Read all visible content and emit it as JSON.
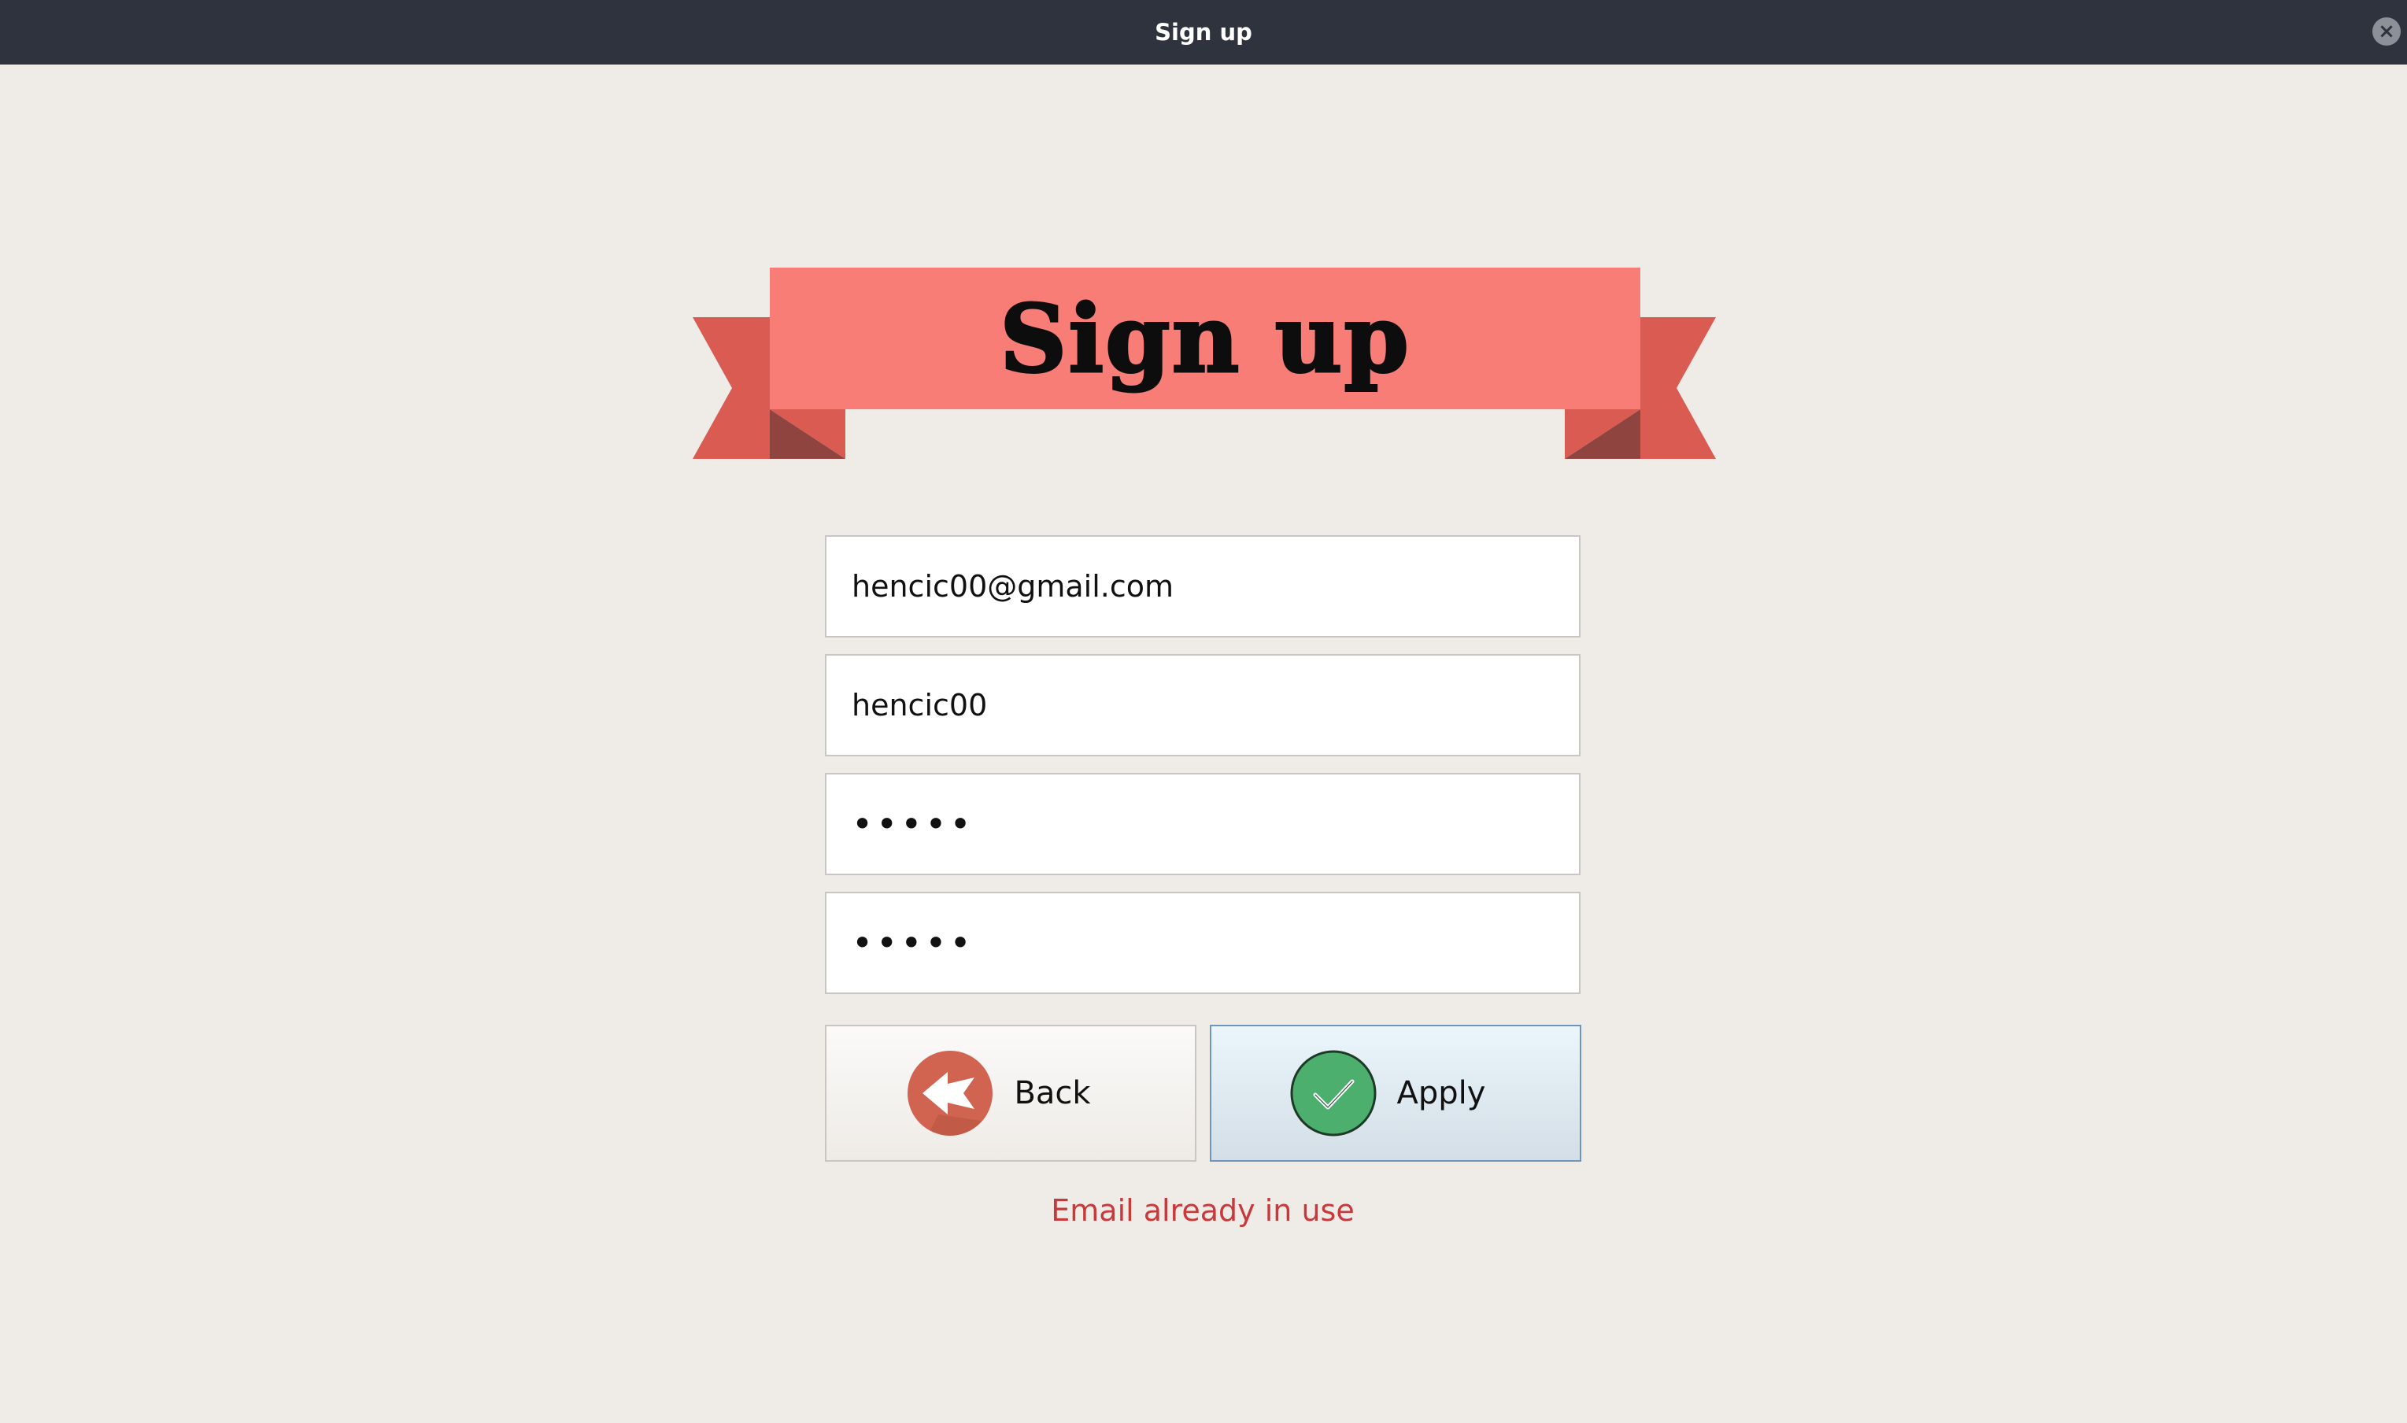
{
  "window": {
    "title": "Sign up",
    "close_symbol": "×"
  },
  "banner": {
    "title": "Sign up",
    "colors": {
      "front": "#f77d76",
      "tail": "#d95b51",
      "fold": "#8f4440"
    }
  },
  "form": {
    "email_value": "hencic00@gmail.com",
    "username_value": "hencic00",
    "password_value": "•••••",
    "confirm_password_value": "•••••"
  },
  "buttons": {
    "back_label": "Back",
    "back_icon": "back-arrow-icon",
    "apply_label": "Apply",
    "apply_icon": "checkmark-icon"
  },
  "status": {
    "error_message": "Email already in use",
    "error_color": "#c8393b"
  }
}
